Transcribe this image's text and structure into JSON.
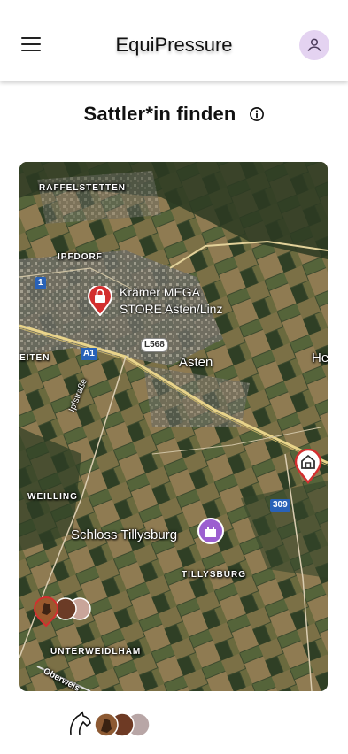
{
  "app": {
    "title": "EquiPressure"
  },
  "page": {
    "title": "Sattler*in finden"
  },
  "map": {
    "labels": {
      "raffelstetten": "RAFFELSTETTEN",
      "ipfdorf": "IPFDORF",
      "store_line1": "Krämer MEGA",
      "store_line2": "STORE Asten/Linz",
      "asten": "Asten",
      "eiten": "EITEN",
      "he": "He",
      "ipfstrasse": "Ipfstraße",
      "weilling": "WEILLING",
      "schloss": "Schloss Tillysburg",
      "tillysburg": "TILLYSBURG",
      "unterweidlham": "UNTERWEIDLHAM",
      "oberweis": "Oberweis"
    },
    "road_shields": {
      "one": "1",
      "a1": "A1",
      "l568": "L568",
      "r309": "309"
    }
  },
  "icons": {
    "menu": "menu-icon",
    "account": "account-icon",
    "info": "info-icon",
    "shop_pin": "shopping-bag-pin-icon",
    "castle_pin": "castle-pin-icon",
    "saddler_pin": "home-pin-icon",
    "horse_pins": "horse-avatar-cluster-icon",
    "logo": "horse-logo-icon"
  },
  "colors": {
    "accent": "#e4d3f1",
    "pin_red": "#d32f2f",
    "castle_purple": "#9c5fd0"
  }
}
